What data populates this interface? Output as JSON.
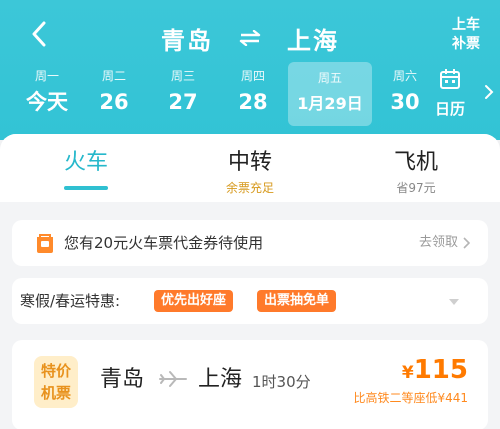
{
  "header": {
    "from_city": "青岛",
    "to_city": "上海",
    "top_right_line1": "上车",
    "top_right_line2": "补票"
  },
  "dates": [
    {
      "weekday": "周一",
      "date": "今天"
    },
    {
      "weekday": "周二",
      "date": "26"
    },
    {
      "weekday": "周三",
      "date": "27"
    },
    {
      "weekday": "周四",
      "date": "28"
    },
    {
      "weekday": "周五",
      "date": "1月29日",
      "selected": true
    },
    {
      "weekday": "周六",
      "date": "30"
    }
  ],
  "calendar_label": "日历",
  "tabs": [
    {
      "title": "火车",
      "subtitle": "",
      "active": true
    },
    {
      "title": "中转",
      "subtitle": "余票充足"
    },
    {
      "title": "飞机",
      "subtitle": "省97元"
    }
  ],
  "coupon": {
    "text": "您有20元火车票代金券待使用",
    "action": "去领取"
  },
  "promo": {
    "label": "寒假/春运特惠:",
    "tags": [
      "优先出好座",
      "出票抽免单"
    ]
  },
  "flight_card": {
    "badge_line1": "特价",
    "badge_line2": "机票",
    "from": "青岛",
    "to": "上海",
    "duration": "1时30分",
    "currency": "¥",
    "price": "115",
    "compare": "比高铁二等座低¥441"
  },
  "colors": {
    "header_bg": "#3cc7d8",
    "accent": "#26b8cb",
    "orange": "#ff7a2b",
    "price": "#ff7a00",
    "tab_sub_gold": "#d79a1e"
  }
}
